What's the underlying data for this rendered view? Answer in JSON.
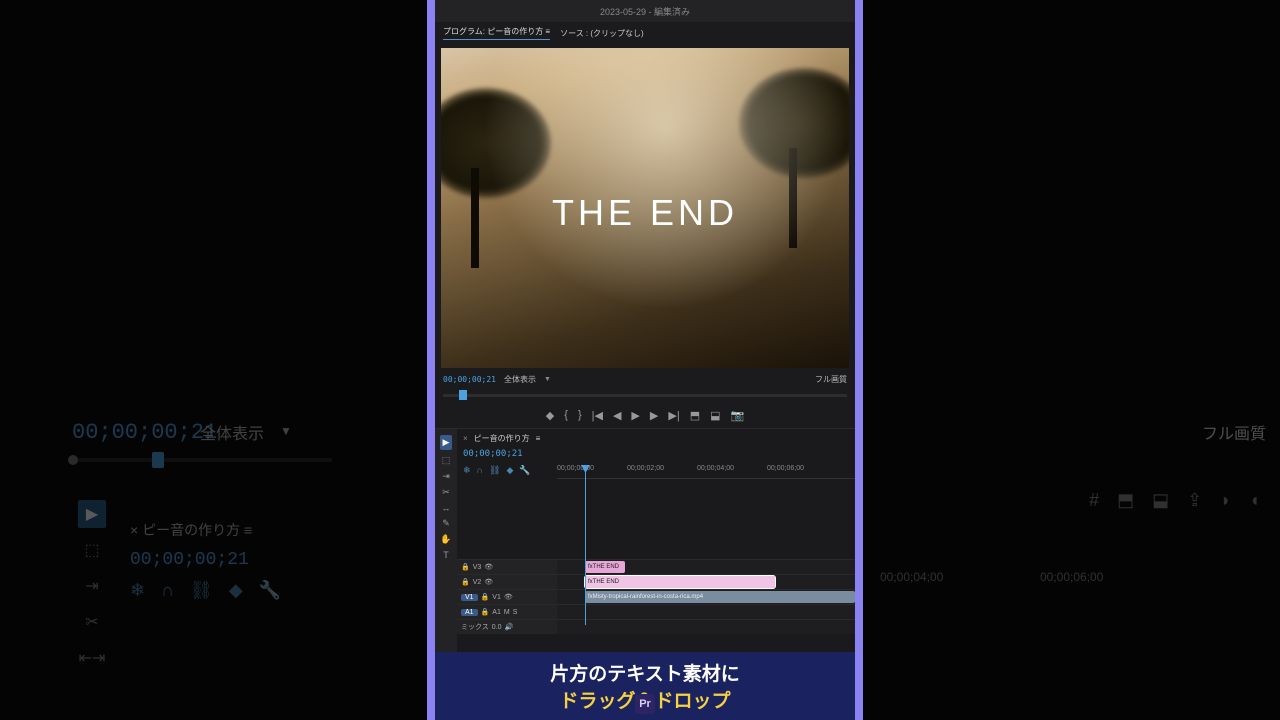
{
  "bg": {
    "timecode": "00;00;00;21",
    "zoom_label": "全体表示",
    "full_quality": "フル画質",
    "seq_tab": "×  ピー音の作り方  ≡",
    "ruler": {
      "t1": "00;00;04;00",
      "t2": "00;00;06;00"
    }
  },
  "app": {
    "title": "2023-05-29 - 編集済み",
    "program_tab": "プログラム: ピー音の作り方  ≡",
    "source_tab": "ソース : (クリップなし)",
    "overlay_text": "THE END",
    "timecode": "00;00;00;21",
    "zoom_label": "全体表示",
    "full_quality": "フル画質"
  },
  "timeline": {
    "seq_name": "ピー音の作り方",
    "timecode": "00;00;00;21",
    "ruler": {
      "r0": "00;00;00;00",
      "r1": "00;00;02;00",
      "r2": "00;00;04;00",
      "r3": "00;00;06;00"
    },
    "tracks": {
      "v3": "V3",
      "v2": "V2",
      "v1": "V1",
      "a1": "A1",
      "mix": "ミックス"
    },
    "clips": {
      "text1": "THE END",
      "text2": "THE END",
      "video": "Misty-tropical-rainforest-in-costa-rica.mp4"
    },
    "mix_val": "0.0"
  },
  "caption": {
    "line1": "片方のテキスト素材に",
    "line2": "ドラッグ＆ドロップ",
    "logo": "Pr"
  }
}
